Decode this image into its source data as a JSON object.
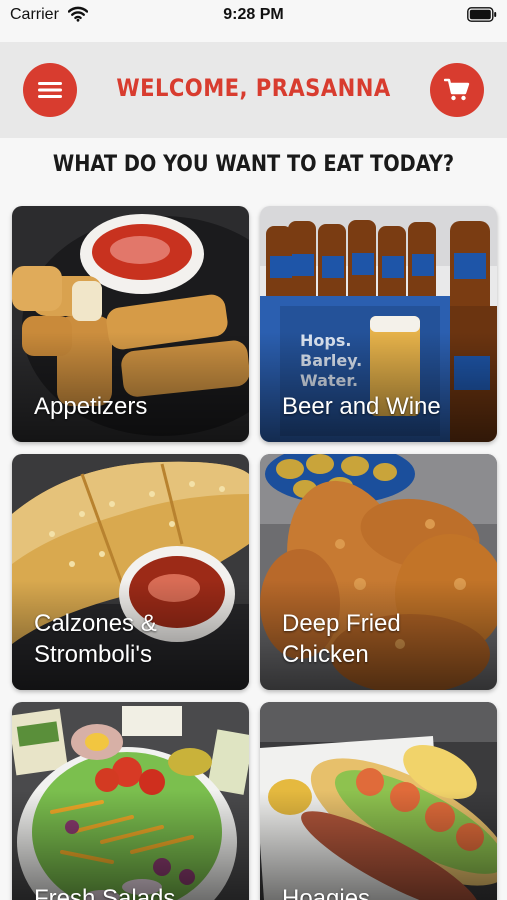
{
  "status_bar": {
    "carrier": "Carrier",
    "time": "9:28 PM",
    "icons": [
      "wifi-icon",
      "battery-icon"
    ]
  },
  "header": {
    "title": "WELCOME, PRASANNA",
    "menu_icon": "menu-icon",
    "cart_icon": "cart-icon"
  },
  "prompt": "WHAT DO YOU WANT TO EAT TODAY?",
  "categories": [
    {
      "label": "Appetizers"
    },
    {
      "label": "Beer and Wine"
    },
    {
      "label": "Calzones &\nStromboli's"
    },
    {
      "label": "Deep Fried\nChicken"
    },
    {
      "label": "Fresh Salads"
    },
    {
      "label": "Hoagies"
    }
  ],
  "colors": {
    "accent": "#d83c2f",
    "header_bg": "#e8e8e8",
    "page_bg": "#f7f7f7"
  }
}
